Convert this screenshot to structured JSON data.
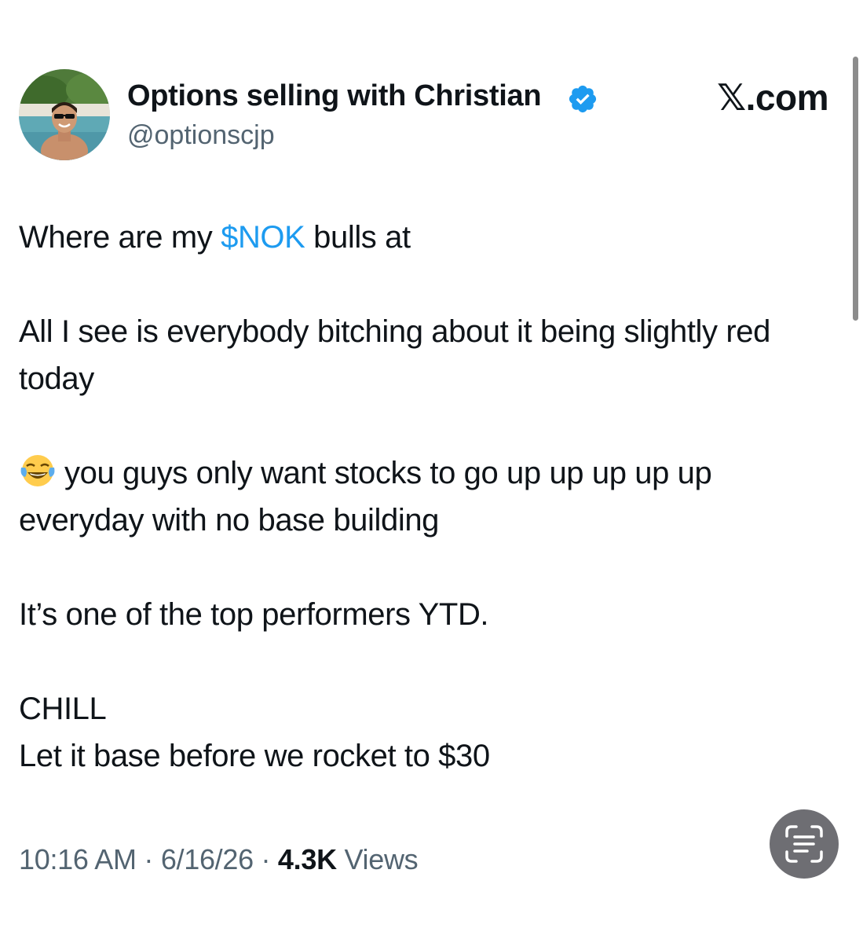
{
  "header": {
    "display_name": "Options selling with Christian",
    "handle": "@optionscjp",
    "verified": true,
    "site_label": ".com",
    "site_glyph": "𝕏"
  },
  "tweet": {
    "paragraphs": [
      {
        "pre": "Where are my ",
        "cashtag": "$NOK",
        "post": " bulls at"
      },
      {
        "text": "All I see is everybody bitching about it being slightly red today"
      },
      {
        "emoji": "face-with-tears-of-joy-icon",
        "text": "you guys only want stocks to go up up up up up everyday with no base building"
      },
      {
        "text": "It’s one of the top performers YTD."
      },
      {
        "line1": "CHILL",
        "line2": "Let it base before we rocket to $30"
      }
    ]
  },
  "meta": {
    "time": "10:16 AM",
    "sep1": " · ",
    "date": "6/16/26",
    "sep2": " · ",
    "views_count": "4.3K",
    "views_label": " Views"
  },
  "colors": {
    "text": "#0f1419",
    "secondary": "#536471",
    "link": "#1d9bf0",
    "verified": "#1d9bf0"
  },
  "icons": {
    "verified": "verified-badge-icon",
    "live_text": "live-text-icon"
  }
}
